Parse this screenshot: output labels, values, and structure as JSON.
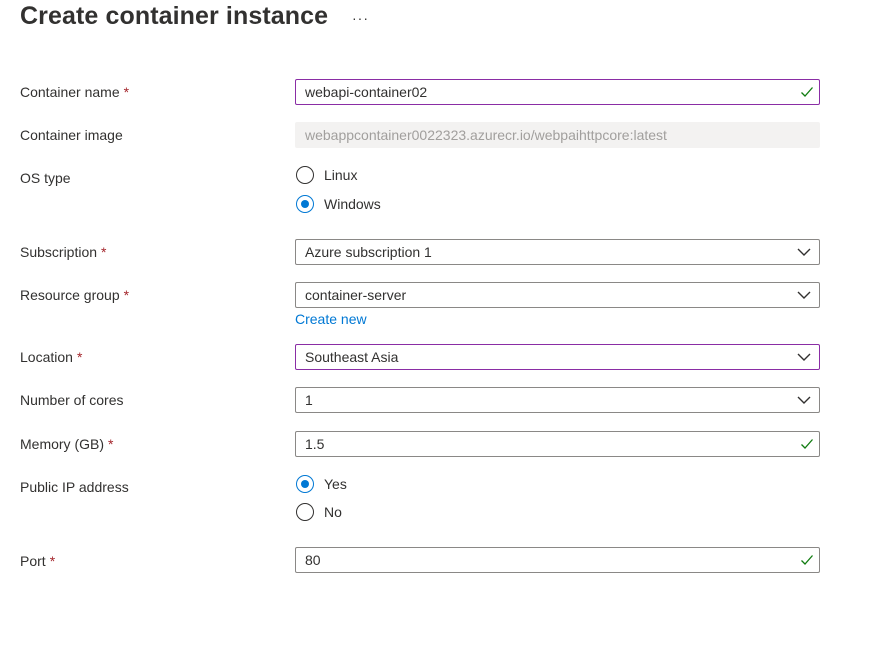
{
  "page": {
    "title": "Create container instance",
    "more_label": "···"
  },
  "form": {
    "container_name": {
      "label": "Container name",
      "required_mark": "*",
      "value": "webapi-container02"
    },
    "container_image": {
      "label": "Container image",
      "value": "webappcontainer0022323.azurecr.io/webpaihttpcore:latest"
    },
    "os_type": {
      "label": "OS type",
      "options": [
        {
          "label": "Linux",
          "checked": false
        },
        {
          "label": "Windows",
          "checked": true
        }
      ]
    },
    "subscription": {
      "label": "Subscription",
      "required_mark": "*",
      "value": "Azure subscription 1"
    },
    "resource_group": {
      "label": "Resource group",
      "required_mark": "*",
      "value": "container-server",
      "create_new_label": "Create new"
    },
    "location": {
      "label": "Location",
      "required_mark": "*",
      "value": "Southeast Asia"
    },
    "cores": {
      "label": "Number of cores",
      "value": "1"
    },
    "memory": {
      "label": "Memory (GB)",
      "required_mark": "*",
      "value": "1.5"
    },
    "public_ip": {
      "label": "Public IP address",
      "options": [
        {
          "label": "Yes",
          "checked": true
        },
        {
          "label": "No",
          "checked": false
        }
      ]
    },
    "port": {
      "label": "Port",
      "required_mark": "*",
      "value": "80"
    }
  },
  "colors": {
    "accent": "#0078d4",
    "focus_border": "#8a2da5",
    "required": "#a4262c",
    "valid_check": "#107c10"
  }
}
